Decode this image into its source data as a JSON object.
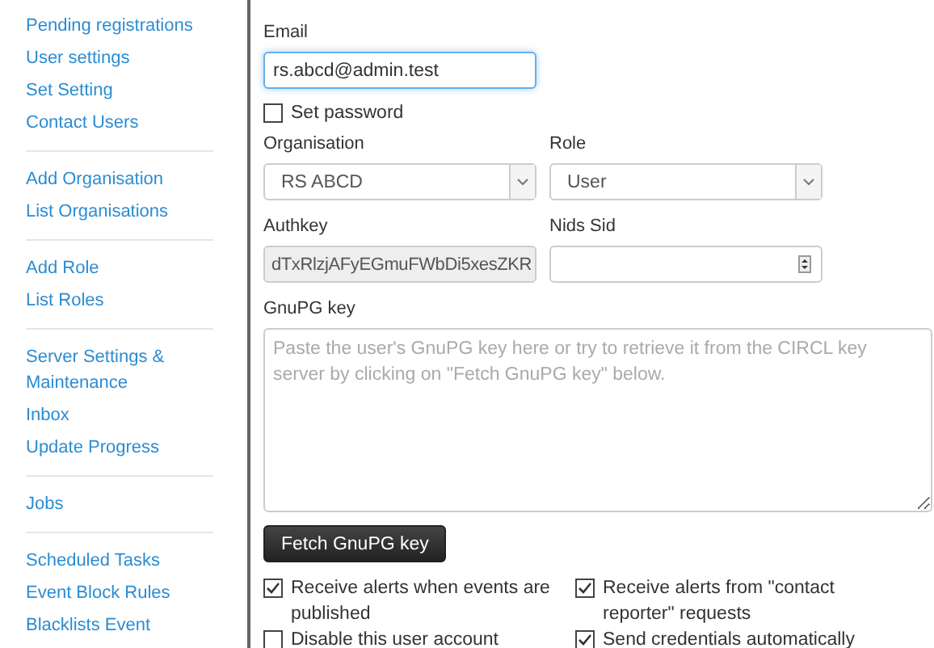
{
  "sidebar": {
    "groups": [
      {
        "items": [
          "Pending registrations",
          "User settings",
          "Set Setting",
          "Contact Users"
        ]
      },
      {
        "items": [
          "Add Organisation",
          "List Organisations"
        ]
      },
      {
        "items": [
          "Add Role",
          "List Roles"
        ]
      },
      {
        "items": [
          "Server Settings & Maintenance",
          "Inbox",
          "Update Progress"
        ]
      },
      {
        "items": [
          "Jobs"
        ]
      },
      {
        "items": [
          "Scheduled Tasks",
          "Event Block Rules",
          "Blacklists Event"
        ]
      }
    ]
  },
  "form": {
    "email": {
      "label": "Email",
      "value": "rs.abcd@admin.test"
    },
    "set_password": {
      "label": "Set password",
      "checked": false
    },
    "organisation": {
      "label": "Organisation",
      "value": "RS ABCD"
    },
    "role": {
      "label": "Role",
      "value": "User"
    },
    "authkey": {
      "label": "Authkey",
      "value": "dTxRlzjAFyEGmuFWbDi5xesZKR",
      "disabled": true
    },
    "nids_sid": {
      "label": "Nids Sid"
    },
    "gnupg": {
      "label": "GnuPG key",
      "placeholder": "Paste the user's GnuPG key here or try to retrieve it from the CIRCL key server by clicking on \"Fetch GnuPG key\" below."
    },
    "fetch_button": "Fetch GnuPG key",
    "options": [
      {
        "label": "Receive alerts when events are published",
        "checked": true
      },
      {
        "label": "Receive alerts from \"contact reporter\" requests",
        "checked": true
      },
      {
        "label": "Disable this user account",
        "checked": false
      },
      {
        "label": "Send credentials automatically",
        "checked": true
      }
    ]
  }
}
